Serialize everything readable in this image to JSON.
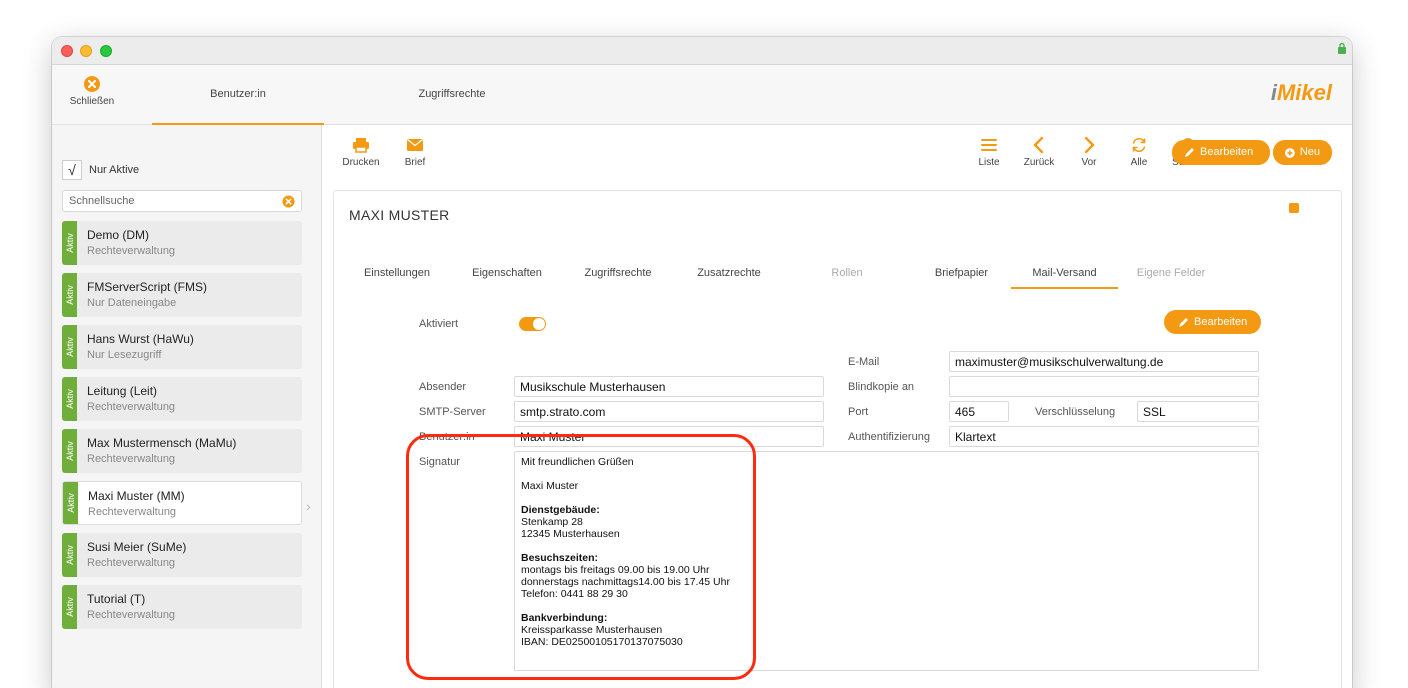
{
  "window": {
    "close_label": "Schließen",
    "top_tabs": [
      "Benutzer:in",
      "Zugriffsrechte"
    ],
    "logo_prefix": "i",
    "logo_text": "Mikel"
  },
  "sidebar": {
    "only_active_label": "Nur Aktive",
    "only_active_check": "√",
    "search_placeholder": "Schnellsuche",
    "status_label": "Aktiv",
    "users": [
      {
        "name": "Demo (DM)",
        "role": "Rechteverwaltung"
      },
      {
        "name": "FMServerScript (FMS)",
        "role": "Nur Dateneingabe"
      },
      {
        "name": "Hans Wurst (HaWu)",
        "role": "Nur Lesezugriff"
      },
      {
        "name": "Leitung (Leit)",
        "role": "Rechteverwaltung"
      },
      {
        "name": "Max Mustermensch (MaMu)",
        "role": "Rechteverwaltung"
      },
      {
        "name": "Maxi Muster (MM)",
        "role": "Rechteverwaltung"
      },
      {
        "name": "Susi Meier (SuMe)",
        "role": "Rechteverwaltung"
      },
      {
        "name": "Tutorial (T)",
        "role": "Rechteverwaltung"
      }
    ],
    "selected_index": 5
  },
  "toolbar": {
    "print": "Drucken",
    "letter": "Brief",
    "list": "Liste",
    "back": "Zurück",
    "forward": "Vor",
    "all": "Alle",
    "search": "Suchen",
    "edit": "Bearbeiten",
    "new": "Neu"
  },
  "record": {
    "title": "MAXI MUSTER",
    "tabs": [
      {
        "label": "Einstellungen",
        "state": "normal"
      },
      {
        "label": "Eigenschaften",
        "state": "normal"
      },
      {
        "label": "Zugriffsrechte",
        "state": "normal"
      },
      {
        "label": "Zusatzrechte",
        "state": "normal"
      },
      {
        "label": "Rollen",
        "state": "disabled"
      },
      {
        "label": "Briefpapier",
        "state": "normal"
      },
      {
        "label": "Mail-Versand",
        "state": "active"
      },
      {
        "label": "Eigene Felder",
        "state": "disabled"
      }
    ],
    "activated_label": "Aktiviert",
    "activated": true,
    "edit_button": "Bearbeiten",
    "email_label": "E-Mail",
    "email": "maximuster@musikschulverwaltung.de",
    "bcc_label": "Blindkopie an",
    "bcc": "",
    "sender_label": "Absender",
    "sender": "Musikschule Musterhausen",
    "smtp_label": "SMTP-Server",
    "smtp": "smtp.strato.com",
    "port_label": "Port",
    "port": "465",
    "encryption_label": "Verschlüsselung",
    "encryption": "SSL",
    "user_label": "Benutzer:in",
    "user": "Maxi Muster",
    "auth_label": "Authentifizierung",
    "auth": "Klartext",
    "signature_label": "Signatur",
    "signature": [
      {
        "text": "Mit freundlichen Grüßen",
        "bold": false
      },
      {
        "text": "",
        "bold": false
      },
      {
        "text": "Maxi Muster",
        "bold": false
      },
      {
        "text": "",
        "bold": false
      },
      {
        "text": "Dienstgebäude:",
        "bold": true
      },
      {
        "text": "Stenkamp 28",
        "bold": false
      },
      {
        "text": "12345 Musterhausen",
        "bold": false
      },
      {
        "text": "",
        "bold": false
      },
      {
        "text": "Besuchszeiten:",
        "bold": true
      },
      {
        "text": "montags bis freitags 09.00 bis 19.00 Uhr",
        "bold": false
      },
      {
        "text": "donnerstags nachmittags14.00 bis 17.45 Uhr",
        "bold": false
      },
      {
        "text": "Telefon: 0441 88 29 30",
        "bold": false
      },
      {
        "text": "",
        "bold": false
      },
      {
        "text": "Bankverbindung:",
        "bold": true
      },
      {
        "text": "Kreissparkasse Musterhausen",
        "bold": false
      },
      {
        "text": "IBAN:  DE02500105170137075030",
        "bold": false
      }
    ]
  },
  "colors": {
    "accent": "#f39a12",
    "active_flag": "#6fae3a",
    "highlight": "#ff2a10"
  }
}
